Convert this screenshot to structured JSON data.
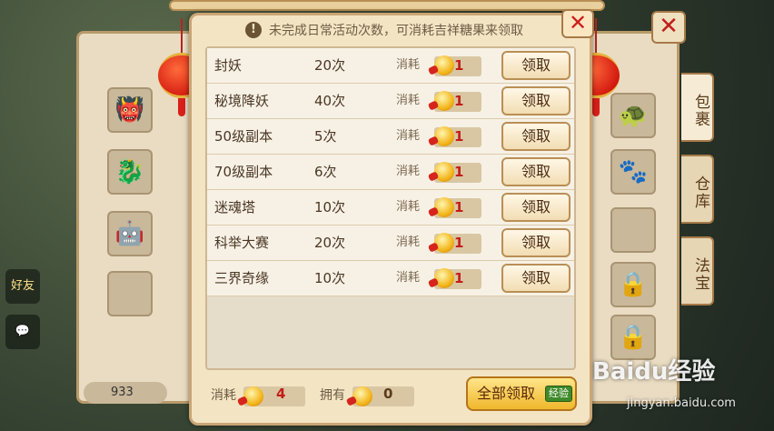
{
  "dialog": {
    "notice_icon": "!",
    "notice_text": "未完成日常活动次数，可消耗吉祥糖果来领取",
    "close_icon": "✕",
    "rows": [
      {
        "name": "封妖",
        "count": "20次",
        "cost_label": "消耗",
        "cost": "1",
        "button": "领取"
      },
      {
        "name": "秘境降妖",
        "count": "40次",
        "cost_label": "消耗",
        "cost": "1",
        "button": "领取"
      },
      {
        "name": "50级副本",
        "count": "5次",
        "cost_label": "消耗",
        "cost": "1",
        "button": "领取"
      },
      {
        "name": "70级副本",
        "count": "6次",
        "cost_label": "消耗",
        "cost": "1",
        "button": "领取"
      },
      {
        "name": "迷魂塔",
        "count": "10次",
        "cost_label": "消耗",
        "cost": "1",
        "button": "领取"
      },
      {
        "name": "科举大赛",
        "count": "20次",
        "cost_label": "消耗",
        "cost": "1",
        "button": "领取"
      },
      {
        "name": "三界奇缘",
        "count": "10次",
        "cost_label": "消耗",
        "cost": "1",
        "button": "领取"
      }
    ],
    "footer": {
      "consume_label": "消耗",
      "consume_value": "4",
      "own_label": "拥有",
      "own_value": "0",
      "claim_all": "全部领取",
      "claim_all_badge": "经验"
    }
  },
  "background": {
    "bag_close_icon": "✕",
    "tabs": [
      "包裹",
      "仓库",
      "法宝"
    ],
    "money": "933",
    "hud": [
      "好友"
    ]
  },
  "watermark": {
    "brand": "Baidu经验",
    "url": "jingyan.baidu.com"
  },
  "colors": {
    "cost_red": "#c31d18",
    "dialog_bg": "#f3e4c3",
    "claim_all": "#f0b72c"
  }
}
